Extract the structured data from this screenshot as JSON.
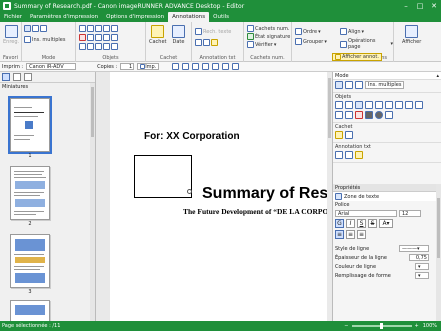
{
  "window": {
    "title": "Summary of Research.pdf - Canon imageRUNNER ADVANCE Desktop - Editor"
  },
  "menu": {
    "tabs": [
      "Fichier",
      "Paramètres d'impression",
      "Options d'impression",
      "Annotations",
      "Outils"
    ],
    "active": "Annotations"
  },
  "ribbon": {
    "favori": {
      "label": "Enreg.",
      "group": "Favori"
    },
    "mode": {
      "label": "Ins. multiples",
      "group": "Mode"
    },
    "objets": {
      "group": "Objets"
    },
    "cachet": {
      "cachet_label": "Cachet",
      "date_label": "Date",
      "group": "Cachet"
    },
    "annot_txt": {
      "search": "Rech. texte",
      "group": "Annotation txt"
    },
    "cachets_num": {
      "cachets": "Cachets num.",
      "etat": "État signature",
      "verifier": "Vérifier",
      "group": "Cachets num."
    },
    "operations": {
      "ordre": "Ordre",
      "grouper": "Grouper",
      "aligner": "Align",
      "ops_page": "Opérations page",
      "group": "Opérations"
    },
    "afficher": {
      "label": "Afficher",
      "annot": "Afficher annot."
    }
  },
  "printrow": {
    "label_imp": "Imprim :",
    "printer": "Canon iR-ADV",
    "copies_label": "Copies :",
    "copies": "1",
    "imp_btn": "Imp."
  },
  "leftpane": {
    "title": "Miniatures",
    "pages": [
      "1",
      "2",
      "3"
    ]
  },
  "document": {
    "for_line": "For: XX Corporation",
    "title": "Summary of Research",
    "subtitle": "The Future Development of “DE LA CORPORATION”"
  },
  "rightpane": {
    "mode_label": "Mode",
    "ins_multiples": "Ins. multiples",
    "objets_label": "Objets",
    "cachet_label": "Cachet",
    "annot_label": "Annotation txt",
    "props_label": "Propriétés",
    "zone_texte": "Zone de texte",
    "police_label": "Police",
    "font_name": "Arial",
    "font_size": "12",
    "style_ligne": "Style de ligne",
    "epaisseur": "Épaisseur de la ligne",
    "epaisseur_value": "0,75",
    "couleur_ligne": "Couleur de ligne",
    "remplissage": "Remplissage de forme"
  },
  "status": {
    "page": "Page sélectionnée : /11",
    "zoom": "100%"
  }
}
